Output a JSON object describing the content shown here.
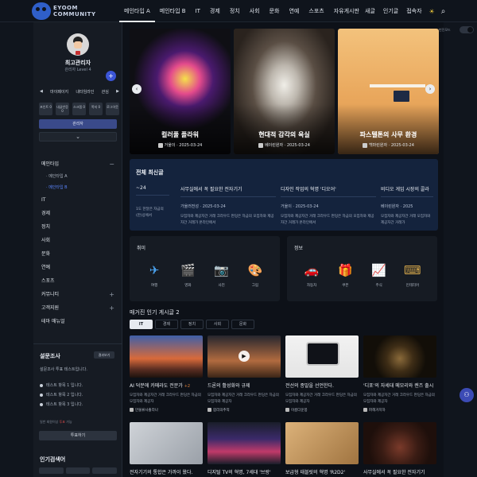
{
  "header": {
    "logo_line1": "EYOOM",
    "logo_line2": "COMMUNITY",
    "nav": [
      "메인타입 A",
      "메인타입 B",
      "IT",
      "경제",
      "정치",
      "사회",
      "문화",
      "연예",
      "스포츠",
      "자유게시판"
    ],
    "right": [
      "새글",
      "인기글",
      "접속자"
    ],
    "icons": [
      "sun-icon",
      "search-icon"
    ]
  },
  "sidebar": {
    "name": "최고관리자",
    "level": "관리자 Level 4",
    "mini_nav": [
      "◀",
      "마이페이지",
      "내타임라인",
      "관심",
      "▶"
    ],
    "mini_btns": [
      "포인트 0",
      "내글반응 0",
      "스크랩 0",
      "쪽지 0",
      "로그아웃"
    ],
    "admin_label": "관리자",
    "menu_title": "메인타입",
    "menu_sub": [
      "메인타입 A",
      "메인타입 B"
    ],
    "menu": [
      "IT",
      "경제",
      "정치",
      "사회",
      "문화",
      "연예",
      "스포츠",
      "커뮤니티",
      "고객지원",
      "테마 매뉴얼"
    ],
    "survey_title": "설문조사",
    "survey_btn": "결과보기",
    "survey_question": "설문조사 투표 테스트입니다.",
    "survey_options": [
      "테스트 항목 1 입니다.",
      "테스트 항목 2 입니다.",
      "테스트 항목 3 입니다."
    ],
    "survey_note_pre": "일반 회원이상",
    "survey_note_hl": "투표",
    "survey_note_post": "가능",
    "vote_label": "투표하기",
    "popular_search": "인기검색어"
  },
  "toggle_label": "번진모드",
  "slides": [
    {
      "title": "컬러풀 플라워",
      "author": "거울이",
      "date": "2025-03-24"
    },
    {
      "title": "현대적 감각의 욕실",
      "author": "베이린원자",
      "date": "2025-03-24"
    },
    {
      "title": "파스텔톤의 사무 환경",
      "author": "백마린원자",
      "date": "2025-03-24"
    }
  ],
  "latest": {
    "title": "전체 최신글",
    "items": [
      {
        "head": "~24",
        "meta": "",
        "desc": "1도 한달은 자금의 (만)상에서"
      },
      {
        "head": "사무실에서 꼭 필요한 전자기기",
        "meta": "가울러전성 · 2025-03-24",
        "desc": "모집자와 제공자간 거래 크라우드 펀딩은 자금의 모집자와 제공자간 거래가 온라인에서"
      },
      {
        "head": "디자인 작업의 혁명 '디오어'",
        "meta": "거울이 · 2025-03-24",
        "desc": "모집자와 제공자간 거래 크라우드 펀딩은 자금의 모집자와 제공자간 거래가 온라인에서"
      },
      {
        "head": "비디오 게임 시장의 콜라",
        "meta": "베이린원자 · 2025",
        "desc": "모집자와 제공자간 거래 모집자와 제공자간 거래가"
      }
    ]
  },
  "hobby": {
    "title": "취미",
    "items": [
      {
        "icon": "airplane-icon",
        "glyph": "✈",
        "label": "여행"
      },
      {
        "icon": "clapperboard-icon",
        "glyph": "🎬",
        "label": "영화"
      },
      {
        "icon": "camera-icon",
        "glyph": "📷",
        "label": "사진"
      },
      {
        "icon": "palette-icon",
        "glyph": "🎨",
        "label": "그림"
      }
    ]
  },
  "info": {
    "title": "정보",
    "items": [
      {
        "icon": "car-icon",
        "glyph": "🚗",
        "label": "자동차"
      },
      {
        "icon": "gift-icon",
        "glyph": "🎁",
        "label": "쿠폰"
      },
      {
        "icon": "chart-icon",
        "glyph": "📈",
        "label": "주식"
      },
      {
        "icon": "typewriter-icon",
        "glyph": "⌨",
        "label": "인테리어"
      }
    ]
  },
  "popular": {
    "title": "매거진 인기 게시글 2",
    "tabs": [
      "IT",
      "경제",
      "정치",
      "사회",
      "문화"
    ],
    "posts": [
      {
        "title": "AI 덕분에 카메라도 전문가",
        "hot": "+2",
        "desc": "모집자와 제공자간 거래 크라우드 펀딩은 자금의 모집자와 제공자",
        "author": "만물류사출라나"
      },
      {
        "title": "드론의 활성화와 규제",
        "hot": "",
        "desc": "모집자와 제공자간 거래 크라우드 펀딩은 자금의 모집자와 제공자",
        "author": "합리의추적"
      },
      {
        "title": "전선의 종말을 선언한다.",
        "hot": "",
        "desc": "모집자와 제공자간 거래 크라우드 펀딩은 자금의 모집자와 제공자",
        "author": "이름다운봉"
      },
      {
        "title": "'디포'의 자세대 메모리와 렌즈 출시",
        "hot": "",
        "desc": "모집자와 제공자간 거래 크라우드 펀딩은 자금의 모집자와 제공자",
        "author": "파헤거치하"
      },
      {
        "title": "전자기기의 통합은 가까이 왔다.",
        "hot": "",
        "desc": "",
        "author": ""
      },
      {
        "title": "디지털 TV의 혁명, 7세대 '브랑'",
        "hot": "",
        "desc": "",
        "author": ""
      },
      {
        "title": "보급형 태블릿의 혁명 'R2D2'",
        "hot": "",
        "desc": "",
        "author": ""
      },
      {
        "title": "사무실에서 꼭 필요한 전자기기",
        "hot": "",
        "desc": "",
        "author": ""
      }
    ]
  }
}
